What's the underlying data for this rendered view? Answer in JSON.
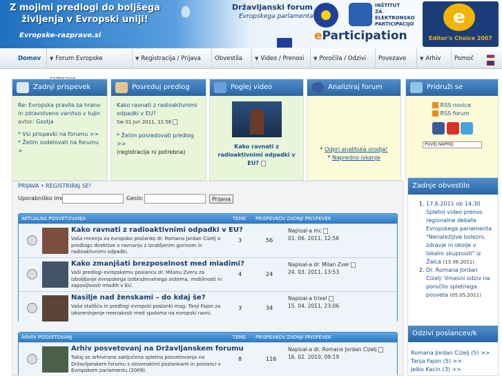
{
  "banner": {
    "slogan": "Z mojimi predlogi do boljšega življenja v Evropski uniji!",
    "site": "Evropske-razprave.si",
    "forum_title": "Državljanski forum",
    "forum_subtitle": "Evropskega parlamenta",
    "institute": [
      "INŠTITUT",
      "ZA",
      "ELEKTRONSKO",
      "PARTICIPACIJO"
    ],
    "eparticipation_prefix": "e",
    "eparticipation_word": "Participation",
    "award_letter": "e",
    "award": "Editor's Choice 2007"
  },
  "nav": {
    "items": [
      {
        "label": "Domov",
        "dropdown": false,
        "active": true
      },
      {
        "label": "Forum Evropske razprave",
        "dropdown": true
      },
      {
        "label": "Registracija / Prijava",
        "dropdown": true
      },
      {
        "label": "Obvestila",
        "dropdown": false
      },
      {
        "label": "Video / Prenosi",
        "dropdown": true
      },
      {
        "label": "Poročila / Odzivi",
        "dropdown": true
      },
      {
        "label": "Povezave",
        "dropdown": false
      },
      {
        "label": "Arhiv",
        "dropdown": true
      },
      {
        "label": "Pomoč",
        "dropdown": false
      }
    ],
    "dropdown_glyph": "▼"
  },
  "boxes": {
    "last_post": {
      "title": "Zadnji prispevek",
      "post_link": "Re: Evropska pravila za hrano in zdravstveno varstvo v tujin",
      "author_label": "avtor:",
      "author": "Gostja",
      "links": [
        "* Vsi prispevki na forumu >>",
        "* Želim sodelovati na forumu >"
      ]
    },
    "send_proposal": {
      "title": "Posreduj predlog",
      "question": "Kako ravnati z radioaktivnimi odpadki v EU?",
      "date": "Sw 01 Jun 2011, 12:58",
      "link": "* Želim posredovati predlog >>",
      "note": "(registracija ni potrebna)"
    },
    "video": {
      "title": "Poglej video",
      "caption": "Kako ravnati z radioaktivnimi odpadki v EU?"
    },
    "analyze": {
      "title": "Analiziraj forum",
      "links": [
        "Odpri analitska orodja!",
        "Napredno iskanje"
      ]
    },
    "join": {
      "title": "Pridruži se",
      "rss": [
        "RSS novice",
        "RSS forum"
      ],
      "bookmark": "POVEJ NAPREJ"
    }
  },
  "login": {
    "links": [
      "PRIJAVA",
      "REGISTRIRAJ SE!"
    ],
    "separator": "•",
    "username_label": "Uporabniško ime:",
    "password_label": "Geslo:",
    "button": "Prijava"
  },
  "current_table": {
    "header": "AKTUALNA POSVETOVANJA",
    "col_topics": "TEME",
    "col_posts": "PRISPEVKOV",
    "col_last": "ZADNJI PRISPEVEK",
    "rows": [
      {
        "title": "Kako ravnati z radioaktivnimi odpadki v EU?",
        "desc": "Vaša mnenja za evropsko poslanko dr. Romano Jordan Cizelj o predlogu direktive o ravnanju z izrabljenim gorivom in radioaktivnimi odpadki.",
        "topics": "3",
        "posts": "56",
        "last_by": "Napisal-a mc",
        "last_date": "01. 06. 2011, 12:56"
      },
      {
        "title": "Kako zmanjšati brezposelnost med mladimi?",
        "desc": "Vaši predlogi evropskemu poslancu dr. Milanu Zveru za izboljšanje evropskega izobraževalnega sistema, mobilnosti in zaposljivosti mladih v EU.",
        "topics": "4",
        "posts": "24",
        "last_by": "Napisal-a dr. Milan Zver",
        "last_date": "24. 03. 2011, 13:53"
      },
      {
        "title": "Nasilje nad ženskami – do kdaj še?",
        "desc": "Vaša stališča in predlogi evropski poslanki mag. Tanji Fajon za izkoreninjenje neenakosti med spoloma na evropski ravni.",
        "topics": "3",
        "posts": "34",
        "last_by": "Napisal-a trixel",
        "last_date": "15. 04. 2011, 23:06"
      }
    ]
  },
  "archive_table": {
    "header": "ARHIV POSVETOVANJ",
    "col_topics": "TEME",
    "col_posts": "PRISPEVKOV",
    "col_last": "ZADNJI PRISPEVEK",
    "rows": [
      {
        "title": "Arhiv posvetovanj na Državljanskem forumu",
        "desc": "Tukaj so arhivirana zaključena spletna posvetovanja na Državljanskem forumu s slovenskimi poslankami in poslanci v Evropskem parlamentu (2009).",
        "topics": "8",
        "posts": "116",
        "last_by": "Napisal-a dr. Romana Jordan Cizelj",
        "last_date": "16. 02. 2010, 09:19"
      }
    ]
  },
  "news": {
    "title": "Zadnje obvestilo",
    "items": [
      {
        "date": "17.6.2011",
        "text": "17.6.2011 ob 14.30 Spletni video prenos regionalne debate Evropskega parlamenta \"Nenalezljive bolezni, zdravje in okolje v lokalni skupnosti\" iz Žalca",
        "stamp": "(13.06.2011)"
      },
      {
        "text": "Dr. Romana Jordan Cizelj: Vmesni odziv na poročilo spletnega posveta",
        "stamp": "(05.05.2011)"
      }
    ]
  },
  "replies": {
    "title": "Odzivi poslancev/k",
    "items": [
      "Romana Jordan Cizelj (5) >>",
      "Tanja Fajon (5) >>",
      "Jelko Kacin (3) >>"
    ]
  }
}
